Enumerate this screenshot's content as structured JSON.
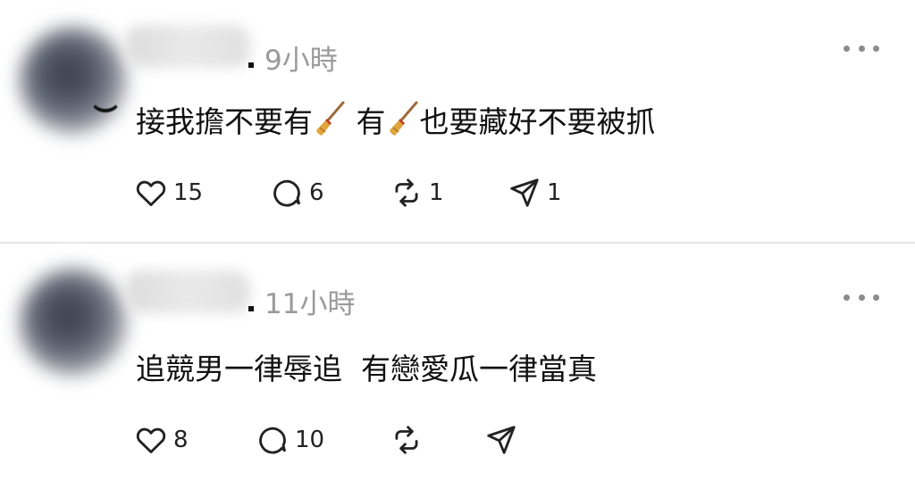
{
  "posts": [
    {
      "time": "9小時",
      "text_parts": [
        "接我擔不要有",
        " 有",
        "也要藏好不要被抓"
      ],
      "actions": {
        "likes": "15",
        "replies": "6",
        "reposts": "1",
        "shares": "1"
      }
    },
    {
      "time": "11小時",
      "text": "追競男一律辱追  有戀愛瓜一律當真",
      "actions": {
        "likes": "8",
        "replies": "10",
        "reposts": "",
        "shares": ""
      }
    }
  ],
  "icons": {
    "like": "heart-icon",
    "reply": "comment-bubble-icon",
    "repost": "repost-arrows-icon",
    "share": "send-icon",
    "more": "more-dots-icon",
    "emoji": "broom-emoji"
  },
  "colors": {
    "text": "#111111",
    "muted": "#9a9a9a",
    "divider": "#e6e6e6"
  }
}
